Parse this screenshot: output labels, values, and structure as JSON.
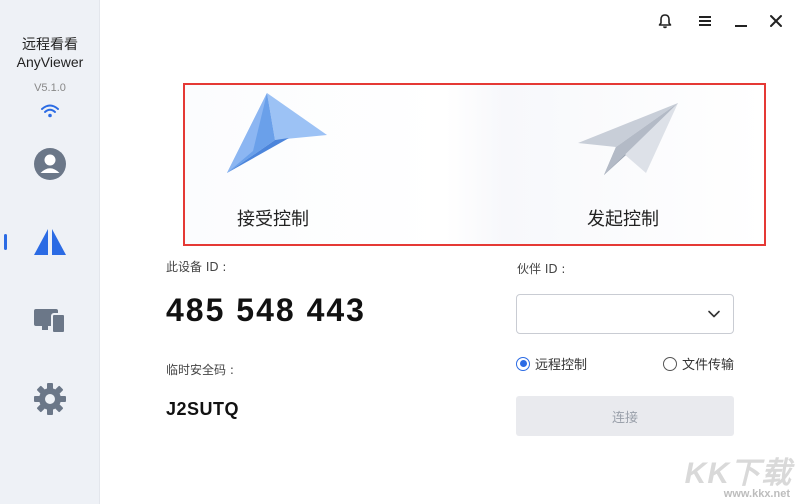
{
  "sidebar": {
    "app_name_cn": "远程看看",
    "app_name_en": "AnyViewer",
    "version": "V5.1.0"
  },
  "modes": {
    "receive": "接受控制",
    "initiate": "发起控制"
  },
  "device": {
    "id_label": "此设备 ID :",
    "id_value": "485 548 443",
    "temp_code_label": "临时安全码 :",
    "temp_code_value": "J2SUTQ"
  },
  "partner": {
    "id_label": "伙伴 ID :",
    "id_value": "",
    "options": [
      {
        "label": "远程控制",
        "selected": true
      },
      {
        "label": "文件传输",
        "selected": false
      }
    ],
    "connect_label": "连接"
  },
  "watermark": {
    "text": "KK下载",
    "url": "www.kkx.net"
  },
  "colors": {
    "accent": "#2b6be4",
    "highlight_border": "#e53935",
    "sidebar_bg": "#eef1f6"
  }
}
